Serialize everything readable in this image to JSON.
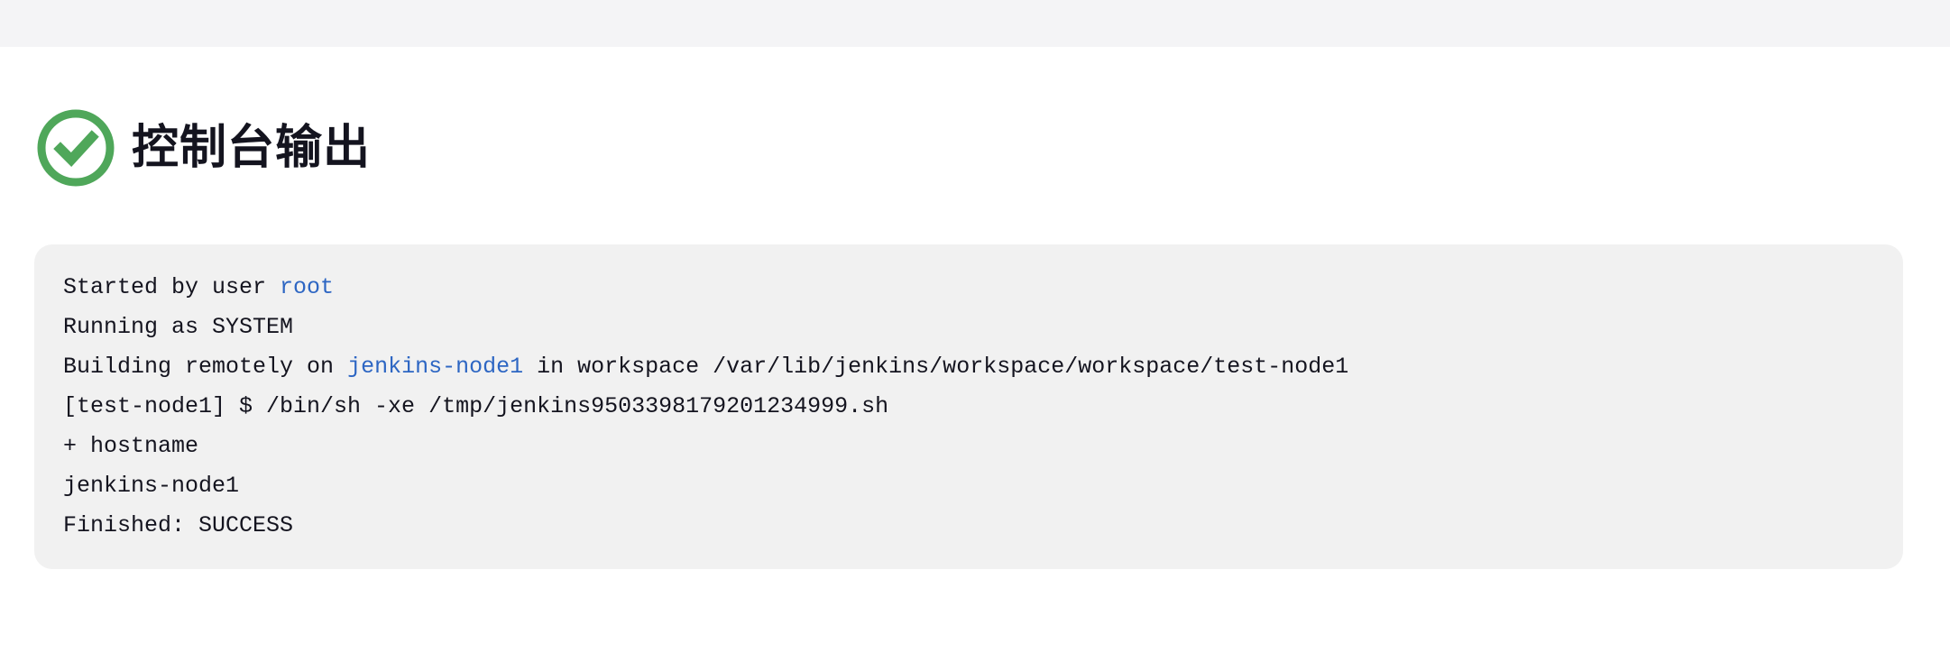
{
  "header": {
    "title": "控制台输出",
    "status": "success",
    "status_icon": "check-circle-icon",
    "status_color": "#4fa75a"
  },
  "console": {
    "line1": {
      "prefix": "Started by user ",
      "link": "root"
    },
    "line2": {
      "text": "Running as SYSTEM"
    },
    "line3": {
      "prefix": "Building remotely on ",
      "link": "jenkins-node1",
      "suffix": " in workspace /var/lib/jenkins/workspace/workspace/test-node1"
    },
    "line4": {
      "text": "[test-node1] $ /bin/sh -xe /tmp/jenkins9503398179201234999.sh"
    },
    "line5": {
      "text": "+ hostname"
    },
    "line6": {
      "text": "jenkins-node1"
    },
    "line7": {
      "text": "Finished: SUCCESS"
    }
  },
  "colors": {
    "link": "#2d66c3",
    "console_bg": "#f1f1f1",
    "top_bar": "#f4f4f6"
  }
}
